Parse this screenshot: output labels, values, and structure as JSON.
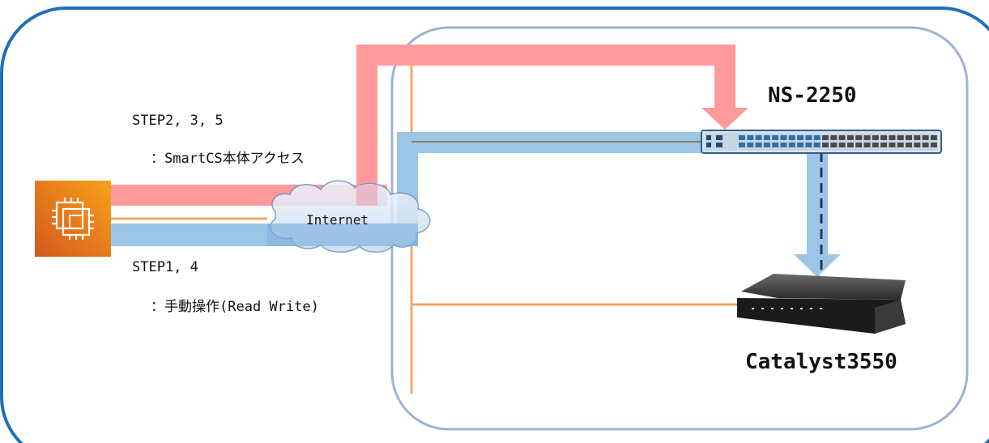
{
  "labels": {
    "step_235": "STEP2, 3, 5",
    "step_235_desc": "：SmartCS本体アクセス",
    "step_14": "STEP1, 4",
    "step_14_desc": "：手動操作(Read Write)",
    "internet": "Internet",
    "ns2250": "NS-2250",
    "catalyst": "Catalyst3550"
  },
  "colors": {
    "outer_border": "#1f6fb9",
    "inner_border": "#9bb3d6",
    "red_path": "#ff9a9c",
    "blue_path": "#9cc5e6",
    "orange_line": "#f0a868",
    "aws_orange_top": "#f7a21b",
    "aws_orange_bottom": "#d4571c",
    "switch_body": "#2f5f8c",
    "router_body": "#2a2a2a"
  },
  "icons": {
    "compute": "aws-ec2-chip-icon",
    "cloud": "internet-cloud-icon",
    "switch": "ns2250-switch-icon",
    "router": "catalyst3550-router-icon"
  }
}
